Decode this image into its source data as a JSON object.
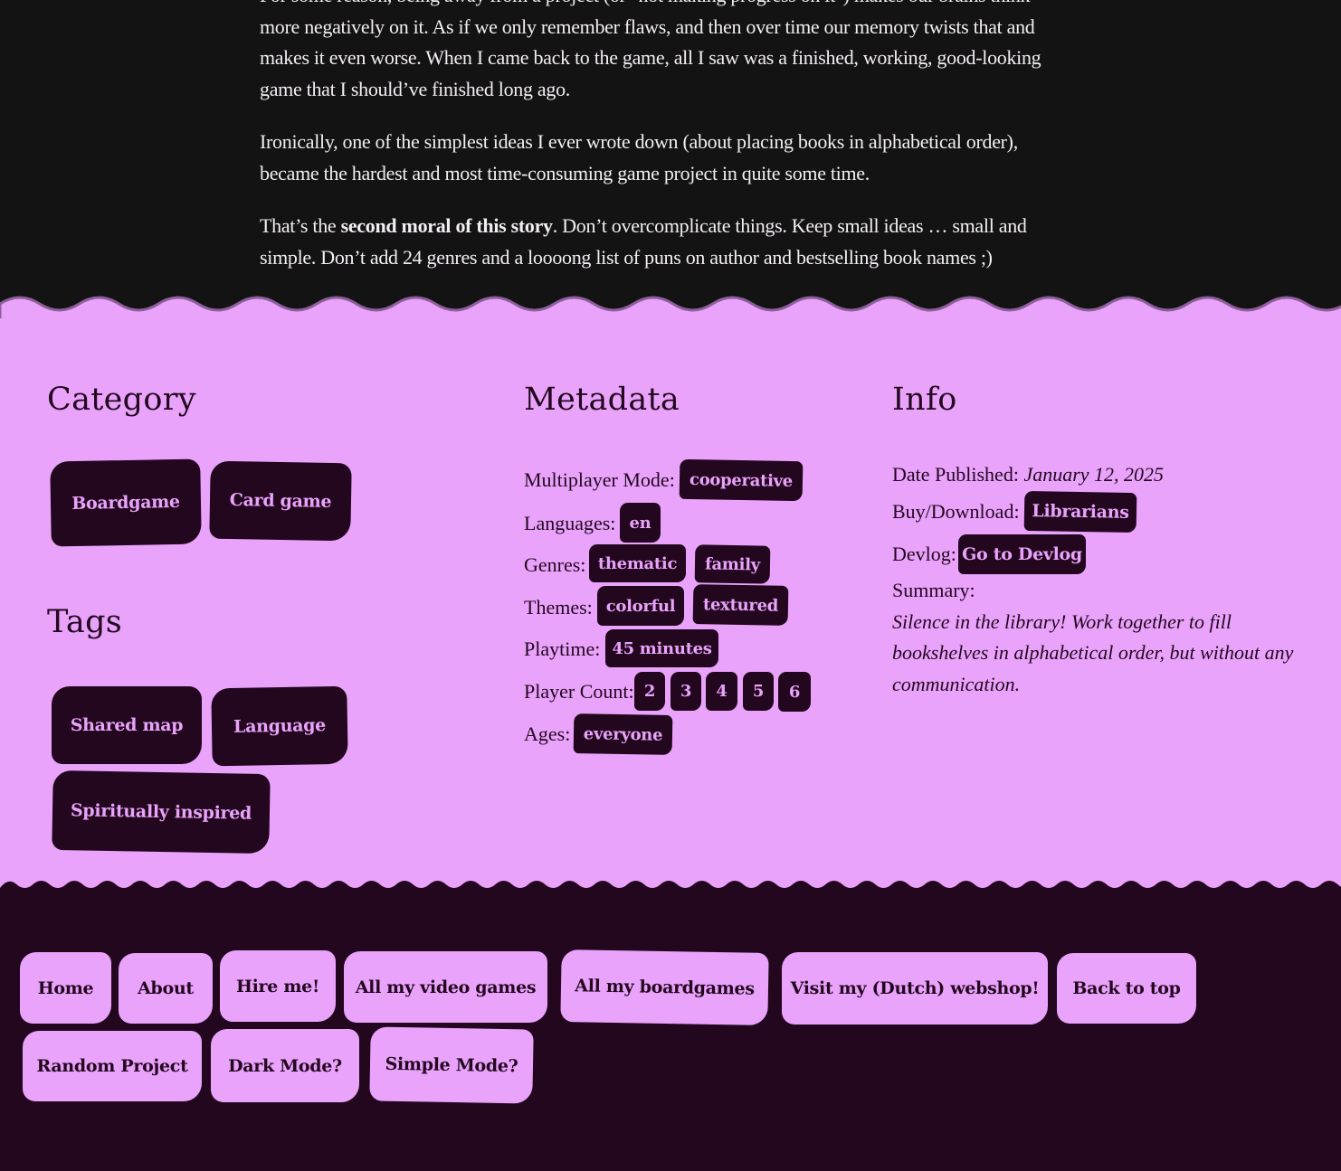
{
  "article": {
    "p1": "For some reason, being away from a project (or \"not making progress on it\") makes our brains think more negatively on it. As if we only remember flaws, and then over time our memory twists that and makes it even worse. When I came back to the game, all I saw was a finished, working, good-looking game that I should’ve finished long ago.",
    "p2": "Ironically, one of the simplest ideas I ever wrote down (about placing books in alphabetical order), became the hardest and most time-consuming game project in quite some time.",
    "p3_before": "That’s the ",
    "p3_bold": "second moral of this story",
    "p3_after": ". Don’t overcomplicate things. Keep small ideas … small and simple. Don’t add 24 genres and a loooong list of puns on author and bestselling book names ;)"
  },
  "category": {
    "title": "Category",
    "items": [
      "Boardgame",
      "Card game"
    ]
  },
  "tags": {
    "title": "Tags",
    "items": [
      "Shared map",
      "Language",
      "Spiritually inspired"
    ]
  },
  "metadata": {
    "title": "Metadata",
    "multiplayer_label": "Multiplayer Mode:",
    "multiplayer_value": "cooperative",
    "languages_label": "Languages:",
    "languages": [
      "en"
    ],
    "genres_label": "Genres:",
    "genres": [
      "thematic",
      "family"
    ],
    "themes_label": "Themes:",
    "themes": [
      "colorful",
      "textured"
    ],
    "playtime_label": "Playtime:",
    "playtime": "45 minutes",
    "player_count_label": "Player Count:",
    "player_counts": [
      "2",
      "3",
      "4",
      "5",
      "6"
    ],
    "ages_label": "Ages:",
    "ages": "everyone"
  },
  "info": {
    "title": "Info",
    "date_label": "Date Published:",
    "date_value": "January 12, 2025",
    "buy_label": "Buy/Download:",
    "buy_value": "Librarians",
    "devlog_label": "Devlog:",
    "devlog_value": "Go to Devlog",
    "summary_label": "Summary:",
    "summary_line1": "Silence in the library! Work together to fill",
    "summary_line2": "bookshelves in alphabetical order, but without any",
    "summary_line3": "communication."
  },
  "footer_nav": {
    "items": [
      "Home",
      "About",
      "Hire me!",
      "All my video games",
      "All my boardgames",
      "Visit my (Dutch) webshop!",
      "Back to top",
      "Random Project",
      "Dark Mode?",
      "Simple Mode?"
    ]
  },
  "colors": {
    "pink": "#eaa3fb",
    "dark_purple": "#23071f",
    "article_bg": "#131313"
  }
}
